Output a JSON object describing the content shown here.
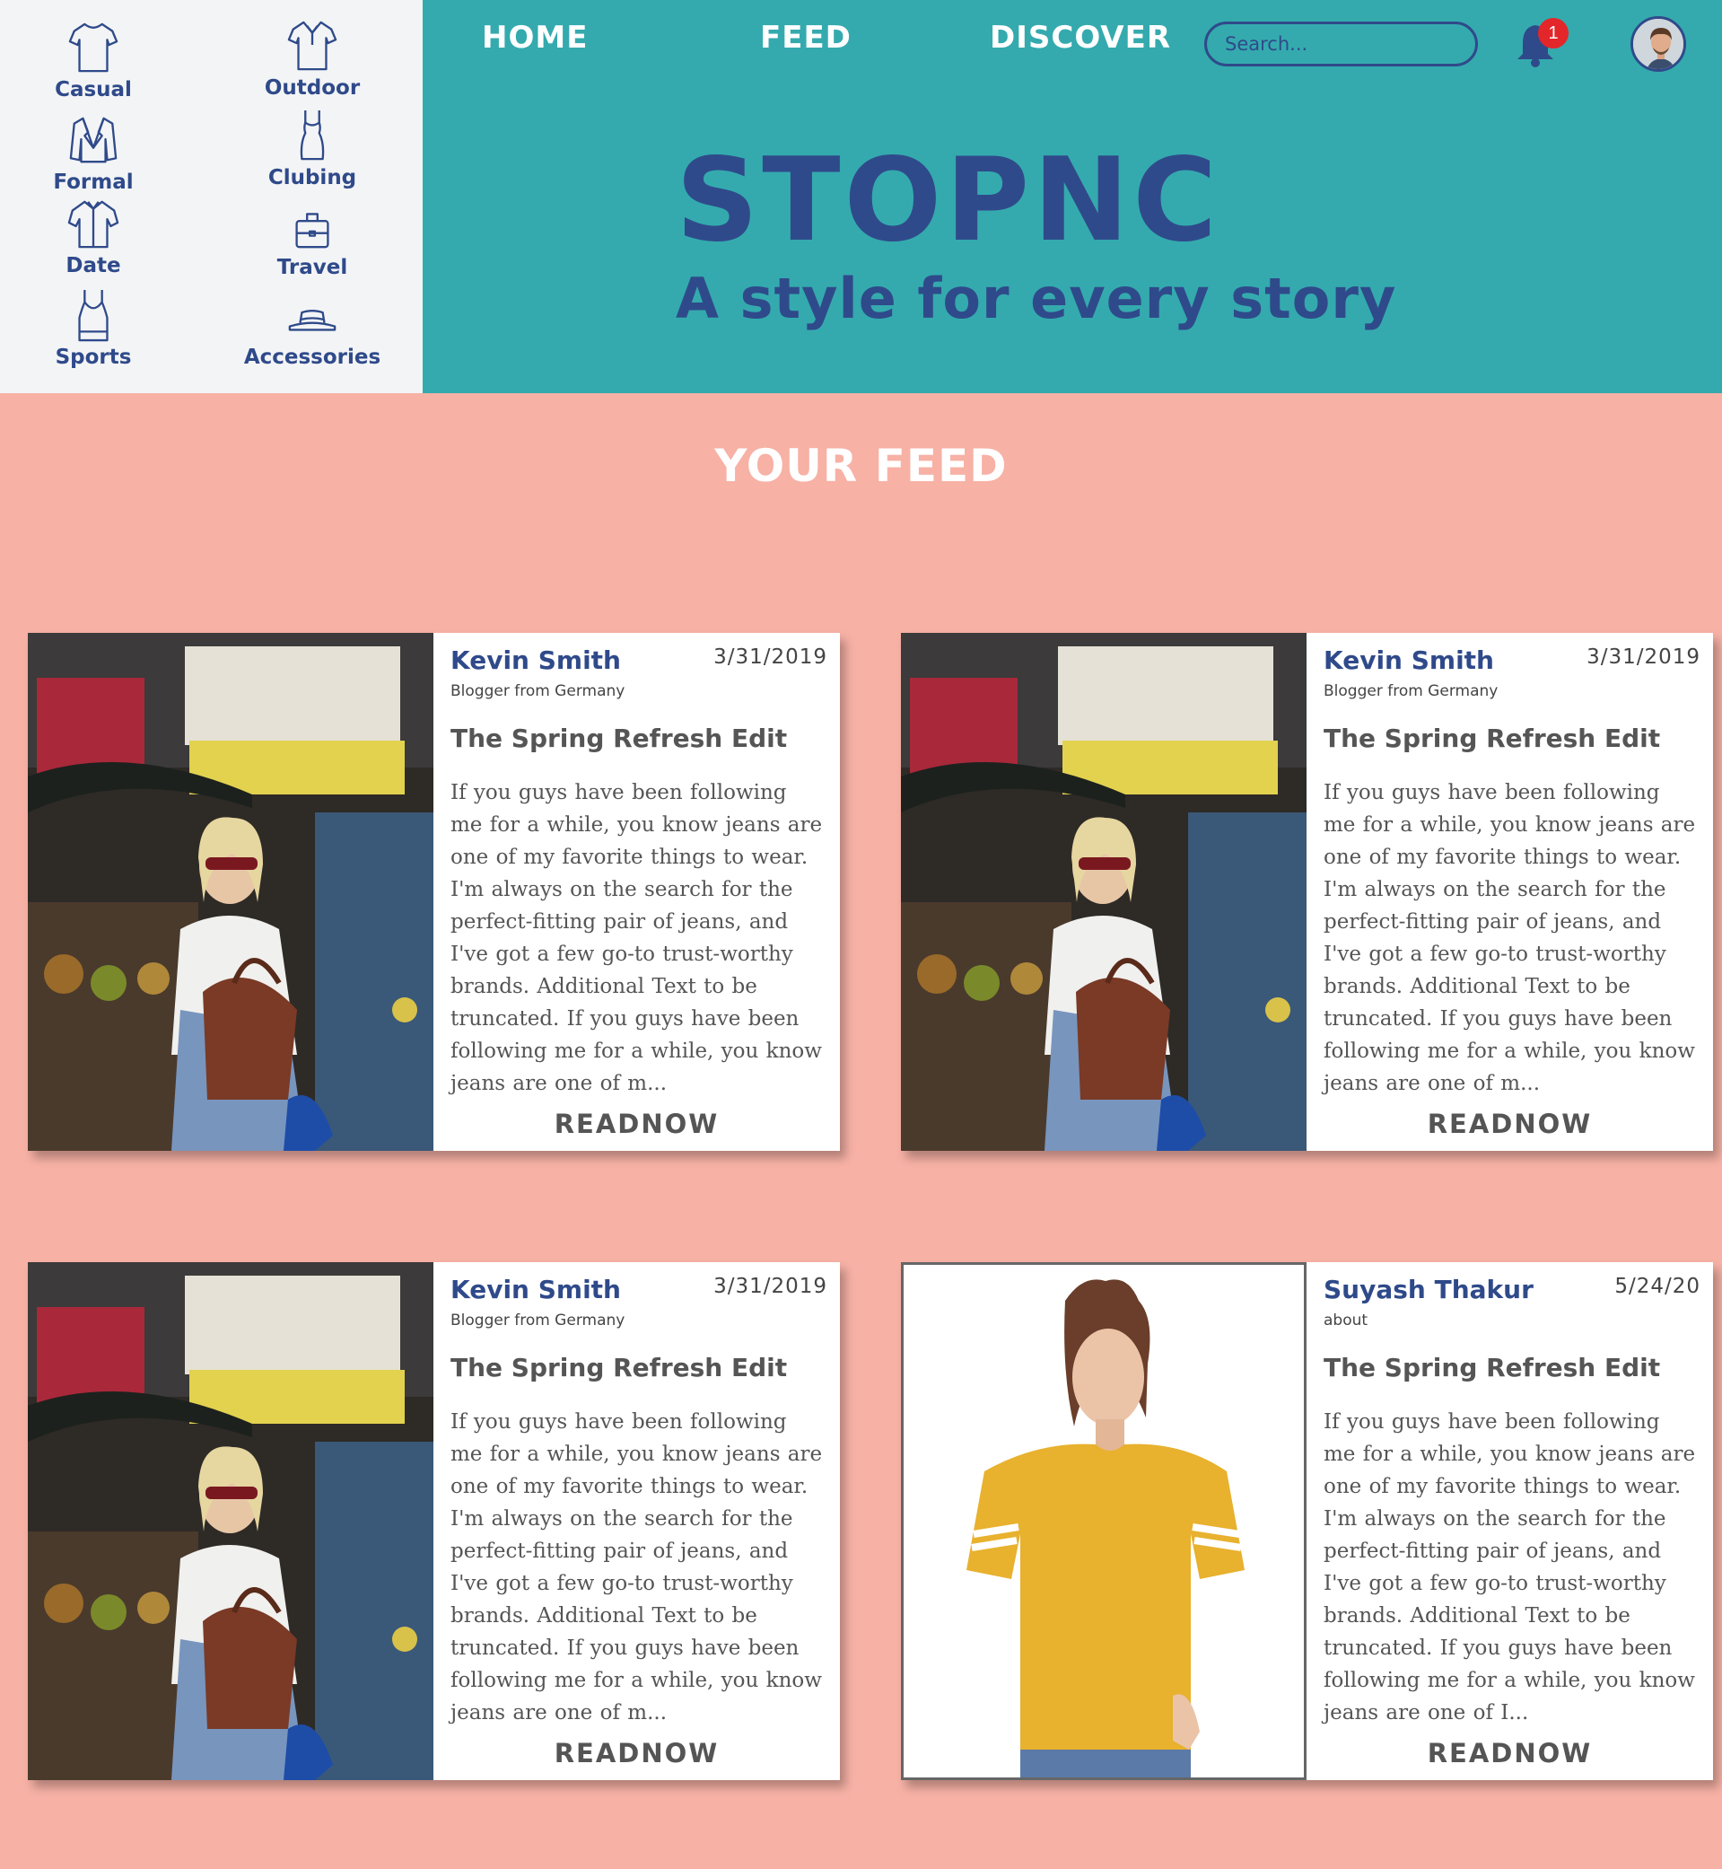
{
  "categories": [
    {
      "label": "Casual",
      "icon": "tshirt-icon"
    },
    {
      "label": "Outdoor",
      "icon": "polo-shirt-icon"
    },
    {
      "label": "Formal",
      "icon": "suit-jacket-icon"
    },
    {
      "label": "Clubing",
      "icon": "dress-icon"
    },
    {
      "label": "Date",
      "icon": "shirt-icon"
    },
    {
      "label": "Travel",
      "icon": "suitcase-icon"
    },
    {
      "label": "Sports",
      "icon": "tank-top-icon"
    },
    {
      "label": "Accessories",
      "icon": "hat-icon"
    }
  ],
  "nav": {
    "home": "HOME",
    "feed": "FEED",
    "discover": "DISCOVER"
  },
  "search": {
    "placeholder": "Search..."
  },
  "notifications": {
    "count": "1"
  },
  "hero": {
    "brand": "STOPNC",
    "tagline": "A style for every story"
  },
  "feed": {
    "title": "YOUR FEED",
    "posts": [
      {
        "author": "Kevin Smith",
        "date": "3/31/2019",
        "subtitle": "Blogger from Germany",
        "title": "The Spring Refresh Edit",
        "excerpt": "If you guys have been following me for a while, you know jeans are one of my favorite things to wear. I'm always on the search for the perfect-fitting pair of jeans, and I've got a few go-to trust-worthy brands. Additional Text to be truncated. If you guys have been following me for a while, you know jeans are one of m...",
        "cta": "READNOW",
        "image": "street-market-woman-photo"
      },
      {
        "author": "Kevin Smith",
        "date": "3/31/2019",
        "subtitle": "Blogger from Germany",
        "title": "The Spring Refresh Edit",
        "excerpt": "If you guys have been following me for a while, you know jeans are one of my favorite things to wear. I'm always on the search for the perfect-fitting pair of jeans, and I've got a few go-to trust-worthy brands. Additional Text to be truncated. If you guys have been following me for a while, you know jeans are one of m...",
        "cta": "READNOW",
        "image": "street-market-woman-photo"
      },
      {
        "author": "Kevin Smith",
        "date": "3/31/2019",
        "subtitle": "Blogger from Germany",
        "title": "The Spring Refresh Edit",
        "excerpt": "If you guys have been following me for a while, you know jeans are one of my favorite things to wear. I'm always on the search for the perfect-fitting pair of jeans, and I've got a few go-to trust-worthy brands. Additional Text to be truncated. If you guys have been following me for a while, you know jeans are one of m...",
        "cta": "READNOW",
        "image": "street-market-woman-photo"
      },
      {
        "author": "Suyash Thakur",
        "date": "5/24/20",
        "subtitle": "about",
        "title": "The Spring Refresh Edit",
        "excerpt": "If you guys have been following me for a while, you know jeans are one of my favorite things to wear. I'm always on the search for the perfect-fitting pair of jeans, and I've got a few go-to trust-worthy brands. Additional Text to be truncated. If you guys have been following me for a while, you know jeans are one of I...",
        "cta": "READNOW",
        "image": "yellow-tshirt-model-photo"
      }
    ]
  },
  "colors": {
    "header_bg": "#34AAAE",
    "sidebar_bg": "#F3F4F6",
    "page_bg": "#F7B1A5",
    "brand_navy": "#2F4A8A",
    "badge_red": "#E3262A",
    "card_text": "#555555"
  }
}
